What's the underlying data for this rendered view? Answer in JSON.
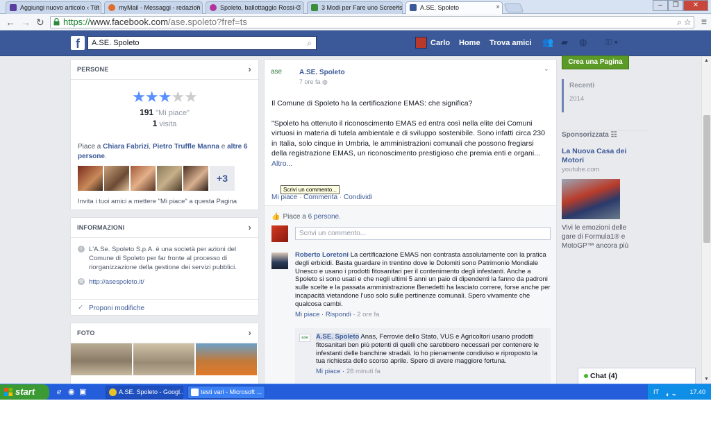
{
  "browser": {
    "tabs": [
      {
        "title": "Aggiungi nuovo articolo ‹ Tut",
        "color": "#5a3ea0"
      },
      {
        "title": "myMail - Messaggi - redazion",
        "color": "#e06b2a"
      },
      {
        "title": "Spoleto, ballottaggio Rossi-C",
        "color": "#b2339c"
      },
      {
        "title": "3 Modi per Fare uno Screens",
        "color": "#3a8d3a"
      },
      {
        "title": "A.SE. Spoleto",
        "color": "#3b5998"
      }
    ],
    "address": {
      "scheme": "https://",
      "host": "www.facebook.com",
      "path": "/ase.spoleto?fref=ts"
    }
  },
  "fb_header": {
    "search_value": "A.SE. Spoleto",
    "user_name": "Carlo",
    "home": "Home",
    "find_friends": "Trova amici"
  },
  "persone": {
    "title": "PERSONE",
    "rating_stars": 3,
    "likes_count": "191",
    "likes_label": "\"Mi piace\"",
    "visits_count": "1",
    "visits_label": "visita",
    "friends_prefix": "Piace a ",
    "friend1": "Chiara Fabrizi",
    "friend2": "Pietro Truffle Manna",
    "friends_and": " e ",
    "friends_more": "altre 6 persone",
    "more_count": "+3",
    "invite": "Invita i tuoi amici a mettere \"Mi piace\" a questa Pagina"
  },
  "informazioni": {
    "title": "INFORMAZIONI",
    "description": "L'A.Se. Spoleto S.p.A. è una società per azioni del Comune di Spoleto per far fronte al processo di riorganizzazione della gestione dei servizi pubblici.",
    "website": "http://asespoleto.it/",
    "edit": "Proponi modifiche"
  },
  "foto": {
    "title": "FOTO"
  },
  "post": {
    "page_name": "A.SE. Spoleto",
    "logo_text": "ase",
    "time": "7 ore fa",
    "paragraph1": "Il Comune di Spoleto ha la certificazione EMAS: che significa?",
    "paragraph2": "\"Spoleto ha ottenuto il riconoscimento EMAS ed entra così nella elite dei Comuni virtuosi in materia di tutela ambientale e di sviluppo sostenibile. Sono infatti circa 230 in Italia, solo cinque in Umbria, le amministrazioni comunali che possono fregiarsi della registrazione EMAS, un riconoscimento prestigioso che premia enti e organi...",
    "more": "Altro...",
    "action_like": "Mi piace",
    "action_comment": "Commenta",
    "action_share": "Condividi",
    "likes_prefix": "Piace a ",
    "likes_link": "6 persone",
    "comment_placeholder": "Scrivi un commento...",
    "tooltip": "Scrivi un commento...",
    "comment": {
      "author": "Roberto Loretoni",
      "text": "La certificazione EMAS non contrasta assolutamente con la pratica degli erbicidi. Basta guardare in trentino dove le Dolomiti sono Patrimonio Mondiale Unesco e usano i prodotti fitosanitari per il contenimento degli infestanti. Anche a Spoleto si sono usati e che negli ultimi 5 anni un paio di dipendenti la fanno da padroni sulle scelte e la passata amministrazione Benedetti ha lasciato correre, forse anche per incapacità vietandone l'uso solo sulle pertinenze comunali. Spero vivamente che qualcosa cambi.",
      "like": "Mi piace",
      "reply": "Rispondi",
      "time": "2 ore fa"
    },
    "reply": {
      "author": "A.SE. Spoleto",
      "text": "Anas, Ferrovie dello Stato, VUS e Agricoltori usano prodotti fitosanitari ben più potenti di quelli che sarebbero necessari per contenere le infestanti delle banchine stradali. Io ho pienamente condiviso e riproposto la tua richiesta dello scorso aprile. Spero di avere maggiore fortuna.",
      "like": "Mi piace",
      "time": "28 minuti fa"
    }
  },
  "right": {
    "create_page": "Crea una Pagina",
    "recent": "Recenti",
    "year": "2014",
    "sponsored": "Sponsorizzata",
    "ad_title": "La Nuova Casa dei Motori",
    "ad_url": "youtube.com",
    "ad_text": "Vivi le emozioni delle gare di Formula1® e MotoGP™ ancora più"
  },
  "chat": {
    "label": "Chat (4)"
  },
  "taskbar": {
    "start": "start",
    "items": [
      "A.SE. Spoleto - Googl...",
      "testi vari - Microsoft ..."
    ],
    "lang": "IT",
    "clock": "17.40"
  },
  "colors": {
    "fb_blue": "#3b5998",
    "create_green": "#5b9a26",
    "taskbar_blue": "#245edb"
  }
}
